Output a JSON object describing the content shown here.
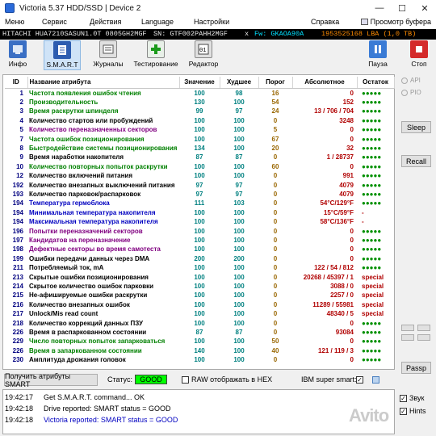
{
  "window": {
    "title": "Victoria 5.37 HDD/SSD | Device 2",
    "controls": [
      "—",
      "☐",
      "✕"
    ]
  },
  "menu": {
    "items": [
      "Меню",
      "Сервис",
      "Действия",
      "Language",
      "Настройки",
      "Справка"
    ],
    "buffer_view": "Просмотр буфера"
  },
  "infobar": {
    "model": "HITACHI HUA7210SASUN1.0T 0805GH2MGF",
    "sn": "SN: GTF002PAHH2MGF",
    "sep": "x",
    "fw": "Fw: GKAOA90A",
    "lba": "1953525168 LBA (1,0 TB)"
  },
  "toolbar": {
    "info": "Инфо",
    "smart": "S.M.A.R.T",
    "logs": "Журналы",
    "testing": "Тестирование",
    "editor": "Редактор",
    "pause": "Пауза",
    "stop": "Стоп"
  },
  "table": {
    "headers": [
      "ID",
      "Название атрибута",
      "Значение",
      "Худшее",
      "Порог",
      "Абсолютное",
      "Остаток"
    ],
    "rows": [
      {
        "id": "1",
        "name": "Частота появления ошибок чтения",
        "c": "#008000",
        "val": "100",
        "worst": "98",
        "thr": "16",
        "abs": "0",
        "rem": "●●●●●"
      },
      {
        "id": "2",
        "name": "Производительность",
        "c": "#008000",
        "val": "130",
        "worst": "100",
        "thr": "54",
        "abs": "152",
        "rem": "●●●●●"
      },
      {
        "id": "3",
        "name": "Время раскрутки шпинделя",
        "c": "#008000",
        "val": "99",
        "worst": "97",
        "thr": "24",
        "abs": "13 / 706 / 704",
        "rem": "●●●●●"
      },
      {
        "id": "4",
        "name": "Количество стартов или пробуждений",
        "c": "#000000",
        "val": "100",
        "worst": "100",
        "thr": "0",
        "abs": "3248",
        "rem": "●●●●●"
      },
      {
        "id": "5",
        "name": "Количество переназначенных секторов",
        "c": "#800080",
        "val": "100",
        "worst": "100",
        "thr": "5",
        "abs": "0",
        "rem": "●●●●●"
      },
      {
        "id": "7",
        "name": "Частота ошибок позиционирования",
        "c": "#008000",
        "val": "100",
        "worst": "100",
        "thr": "67",
        "abs": "0",
        "rem": "●●●●●"
      },
      {
        "id": "8",
        "name": "Быстродействие системы позиционирования",
        "c": "#008000",
        "val": "134",
        "worst": "100",
        "thr": "20",
        "abs": "32",
        "rem": "●●●●●"
      },
      {
        "id": "9",
        "name": "Время наработки накопителя",
        "c": "#000000",
        "val": "87",
        "worst": "87",
        "thr": "0",
        "abs": "1 / 28737",
        "rem": "●●●●●"
      },
      {
        "id": "10",
        "name": "Количество повторных попыток раскрутки",
        "c": "#008000",
        "val": "100",
        "worst": "100",
        "thr": "60",
        "abs": "0",
        "rem": "●●●●●"
      },
      {
        "id": "12",
        "name": "Количество включений питания",
        "c": "#000000",
        "val": "100",
        "worst": "100",
        "thr": "0",
        "abs": "991",
        "rem": "●●●●●"
      },
      {
        "id": "192",
        "name": "Количество внезапных выключений питания",
        "c": "#000000",
        "val": "97",
        "worst": "97",
        "thr": "0",
        "abs": "4079",
        "rem": "●●●●●"
      },
      {
        "id": "193",
        "name": "Количество парковок/распарковок",
        "c": "#000000",
        "val": "97",
        "worst": "97",
        "thr": "0",
        "abs": "4079",
        "rem": "●●●●●"
      },
      {
        "id": "194",
        "name": "Температура гермоблока",
        "c": "#0000c0",
        "val": "111",
        "worst": "103",
        "thr": "0",
        "abs": "54°C/129°F",
        "rem": "●●●●●"
      },
      {
        "id": "194",
        "name": "Минимальная температура накопителя",
        "c": "#0000c0",
        "val": "100",
        "worst": "100",
        "thr": "0",
        "abs": "15°C/59°F",
        "rem": "-"
      },
      {
        "id": "194",
        "name": "Максимальная температура накопителя",
        "c": "#0000c0",
        "val": "100",
        "worst": "100",
        "thr": "0",
        "abs": "58°C/136°F",
        "rem": "-"
      },
      {
        "id": "196",
        "name": "Попытки переназначений секторов",
        "c": "#800080",
        "val": "100",
        "worst": "100",
        "thr": "0",
        "abs": "0",
        "rem": "●●●●●"
      },
      {
        "id": "197",
        "name": "Кандидатов на переназначение",
        "c": "#800080",
        "val": "100",
        "worst": "100",
        "thr": "0",
        "abs": "0",
        "rem": "●●●●●"
      },
      {
        "id": "198",
        "name": "Дефектные секторы во время самотеста",
        "c": "#800080",
        "val": "100",
        "worst": "100",
        "thr": "0",
        "abs": "0",
        "rem": "●●●●●"
      },
      {
        "id": "199",
        "name": "Ошибки передачи данных через DMA",
        "c": "#000000",
        "val": "200",
        "worst": "200",
        "thr": "0",
        "abs": "0",
        "rem": "●●●●●"
      },
      {
        "id": "211",
        "name": "Потребляемый ток, mA",
        "c": "#000000",
        "val": "100",
        "worst": "100",
        "thr": "0",
        "abs": "122 / 54 / 812",
        "rem": "●●●●●"
      },
      {
        "id": "213",
        "name": "Скрытые ошибки позиционирования",
        "c": "#000000",
        "val": "100",
        "worst": "100",
        "thr": "0",
        "abs": "20268 / 45397 / 1",
        "rem": "special"
      },
      {
        "id": "214",
        "name": "Скрытое количество ошибок парковки",
        "c": "#000000",
        "val": "100",
        "worst": "100",
        "thr": "0",
        "abs": "3088 / 0",
        "rem": "special"
      },
      {
        "id": "215",
        "name": "Не-афишируемые ошибки раскрутки",
        "c": "#000000",
        "val": "100",
        "worst": "100",
        "thr": "0",
        "abs": "2257 / 0",
        "rem": "special"
      },
      {
        "id": "216",
        "name": "Количество внезапных ошибок",
        "c": "#000000",
        "val": "100",
        "worst": "100",
        "thr": "0",
        "abs": "11289 / 55981",
        "rem": "special"
      },
      {
        "id": "217",
        "name": "Unlock/Mis read count",
        "c": "#000000",
        "val": "100",
        "worst": "100",
        "thr": "0",
        "abs": "48340 / 5",
        "rem": "special"
      },
      {
        "id": "218",
        "name": "Количество коррекций данных ПЗУ",
        "c": "#000000",
        "val": "100",
        "worst": "100",
        "thr": "0",
        "abs": "0",
        "rem": "●●●●●"
      },
      {
        "id": "226",
        "name": "Время в распаркованном состоянии",
        "c": "#000000",
        "val": "87",
        "worst": "87",
        "thr": "0",
        "abs": "93084",
        "rem": "●●●●●"
      },
      {
        "id": "229",
        "name": "Число повторных попыток запарковаться",
        "c": "#008000",
        "val": "100",
        "worst": "100",
        "thr": "50",
        "abs": "0",
        "rem": "●●●●●"
      },
      {
        "id": "226",
        "name": "Время в запаркованном состоянии",
        "c": "#008000",
        "val": "140",
        "worst": "100",
        "thr": "40",
        "abs": "121 / 119 / 3",
        "rem": "●●●●●"
      },
      {
        "id": "230",
        "name": "Амплитуда дрожания головок",
        "c": "#000000",
        "val": "100",
        "worst": "100",
        "thr": "0",
        "abs": "0",
        "rem": "●●●●●"
      }
    ]
  },
  "side": {
    "api": "API",
    "pio": "PIO",
    "sleep": "Sleep",
    "recall": "Recall",
    "passp": "Passp"
  },
  "statusbar": {
    "get_btn": "Получить атрибуты SMART",
    "status_label": "Статус:",
    "status_value": "GOOD",
    "status_color": "#00ff00",
    "hex_label": "RAW отображать в HEX",
    "ibm_label": "IBM super smart:",
    "ibm_check": "✓"
  },
  "log": [
    {
      "time": "19:42:17",
      "msg": "Get S.M.A.R.T. command... OK",
      "color": "black"
    },
    {
      "time": "19:42:18",
      "msg": "Drive reported: SMART status = GOOD",
      "color": "black"
    },
    {
      "time": "19:42:18",
      "msg": "Victoria reported: SMART status = GOOD",
      "color": "blue"
    }
  ],
  "bottom_right": {
    "sound": "Звук",
    "sound_check": "✓",
    "hints": "Hints",
    "hints_check": "✓"
  },
  "watermark": "Avito"
}
